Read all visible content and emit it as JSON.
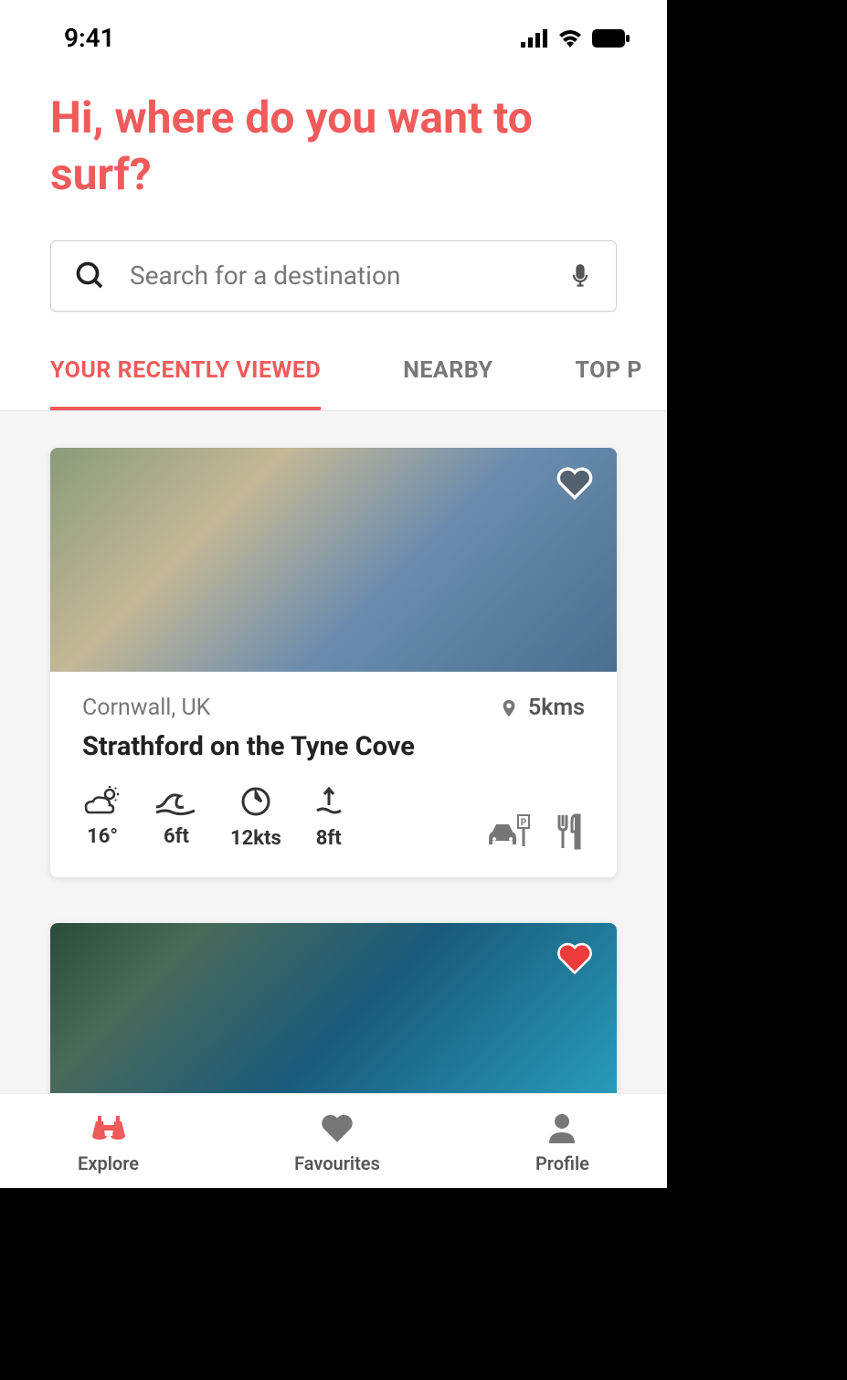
{
  "status": {
    "time": "9:41"
  },
  "header": {
    "title": "Hi, where do you want to surf?"
  },
  "search": {
    "placeholder": "Search for a destination"
  },
  "tabs": [
    {
      "label": "YOUR RECENTLY VIEWED",
      "active": true
    },
    {
      "label": "NEARBY",
      "active": false
    },
    {
      "label": "TOP P",
      "active": false
    }
  ],
  "cards": [
    {
      "location": "Cornwall, UK",
      "distance": "5kms",
      "title": "Strathford on the Tyne Cove",
      "favourite": false,
      "stats": {
        "temp": "16°",
        "wave": "6ft",
        "wind": "12kts",
        "swell": "8ft"
      }
    },
    {
      "favourite": true
    }
  ],
  "nav": {
    "explore": "Explore",
    "favourites": "Favourites",
    "profile": "Profile"
  }
}
